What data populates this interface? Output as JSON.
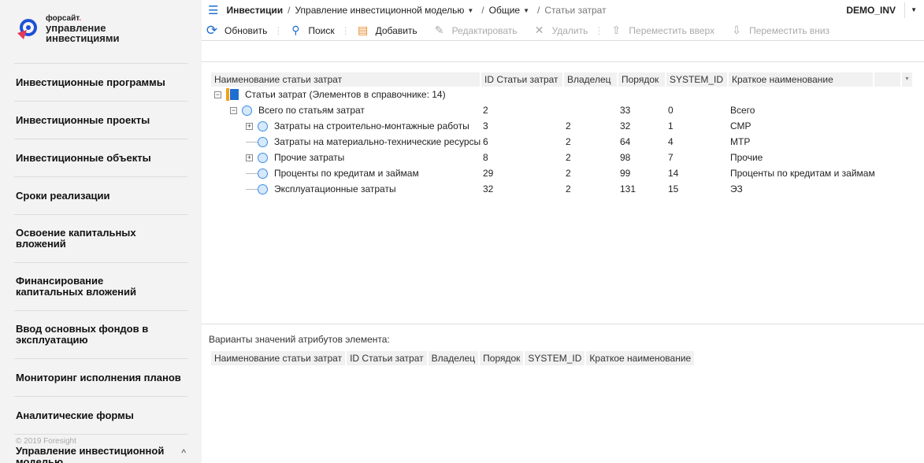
{
  "logo": {
    "brand": "форсайт",
    "title_line1": "управление",
    "title_line2": "инвестициями"
  },
  "sidebar": {
    "items": [
      {
        "label": "Инвестиционные программы"
      },
      {
        "label": "Инвестиционные проекты"
      },
      {
        "label": "Инвестиционные объекты"
      },
      {
        "label": "Сроки реализации"
      },
      {
        "label": "Освоение капитальных вложений"
      },
      {
        "label": "Финансирование капитальных вложений"
      },
      {
        "label": "Ввод основных фондов в эксплуатацию"
      },
      {
        "label": "Мониторинг исполнения планов"
      },
      {
        "label": "Аналитические формы"
      }
    ],
    "copyright": "© 2019 Foresight",
    "footer_title": "Управление инвестиционной моделью"
  },
  "breadcrumb": {
    "root": "Инвестиции",
    "level1": "Управление инвестиционной моделью",
    "level2": "Общие",
    "current": "Статьи затрат"
  },
  "user": "DEMO_INV",
  "toolbar": {
    "refresh": "Обновить",
    "search": "Поиск",
    "add": "Добавить",
    "edit": "Редактировать",
    "delete": "Удалить",
    "move_up": "Переместить вверх",
    "move_down": "Переместить вниз"
  },
  "grid": {
    "columns": [
      "Наименование статьи затрат",
      "ID Статьи затрат",
      "Владелец",
      "Порядок",
      "SYSTEM_ID",
      "Краткое наименование"
    ],
    "root": "Статьи затрат (Элементов в справочнике: 14)",
    "rows": [
      {
        "name": "Всего по статьям затрат",
        "id": "2",
        "owner": "",
        "order": "33",
        "sysid": "0",
        "short": "Всего"
      },
      {
        "name": "Затраты на строительно-монтажные работы",
        "id": "3",
        "owner": "2",
        "order": "32",
        "sysid": "1",
        "short": "СМР"
      },
      {
        "name": "Затраты на материально-технические ресурсы",
        "id": "6",
        "owner": "2",
        "order": "64",
        "sysid": "4",
        "short": "МТР"
      },
      {
        "name": "Прочие затраты",
        "id": "8",
        "owner": "2",
        "order": "98",
        "sysid": "7",
        "short": "Прочие"
      },
      {
        "name": "Проценты по кредитам и займам",
        "id": "29",
        "owner": "2",
        "order": "99",
        "sysid": "14",
        "short": "Проценты по кредитам и займам"
      },
      {
        "name": "Эксплуатационные затраты",
        "id": "32",
        "owner": "2",
        "order": "131",
        "sysid": "15",
        "short": "ЭЗ"
      }
    ]
  },
  "attributes": {
    "label": "Варианты значений атрибутов элемента:",
    "columns": [
      "Наименование статьи затрат",
      "ID Статьи затрат",
      "Владелец",
      "Порядок",
      "SYSTEM_ID",
      "Краткое наименование"
    ]
  }
}
